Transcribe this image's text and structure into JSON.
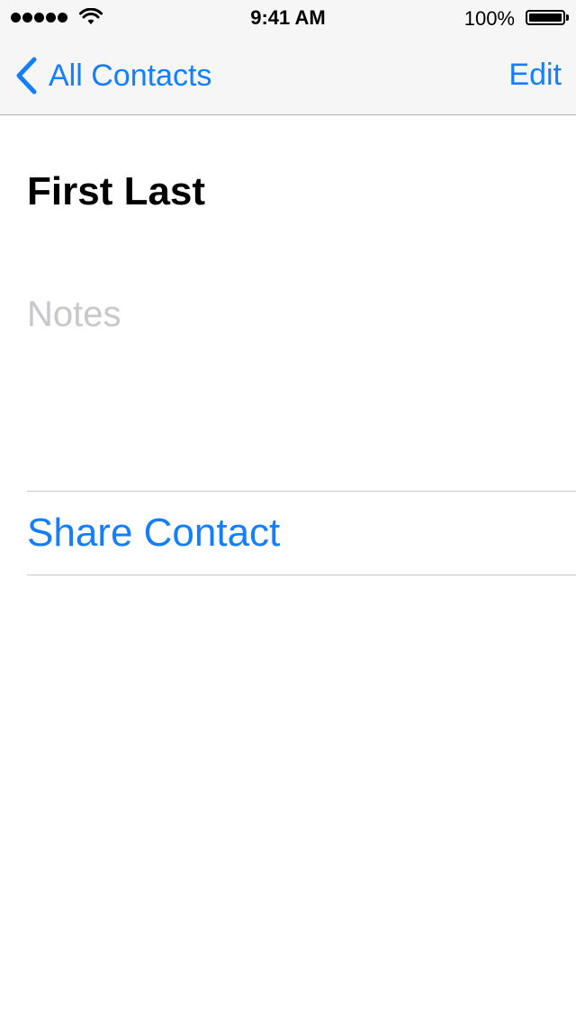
{
  "status_bar": {
    "time": "9:41 AM",
    "battery_percent": "100%",
    "signal_bars": 5,
    "icons": [
      "signal-dots-icon",
      "wifi-icon",
      "battery-icon"
    ]
  },
  "nav": {
    "back_label": "All Contacts",
    "edit_label": "Edit"
  },
  "contact": {
    "name": "First Last",
    "notes_placeholder": "Notes"
  },
  "actions": {
    "share_label": "Share Contact"
  },
  "colors": {
    "accent": "#147efb",
    "bar_background": "#f6f6f6",
    "placeholder": "#c7c7cc",
    "separator": "#c8c7cc"
  }
}
